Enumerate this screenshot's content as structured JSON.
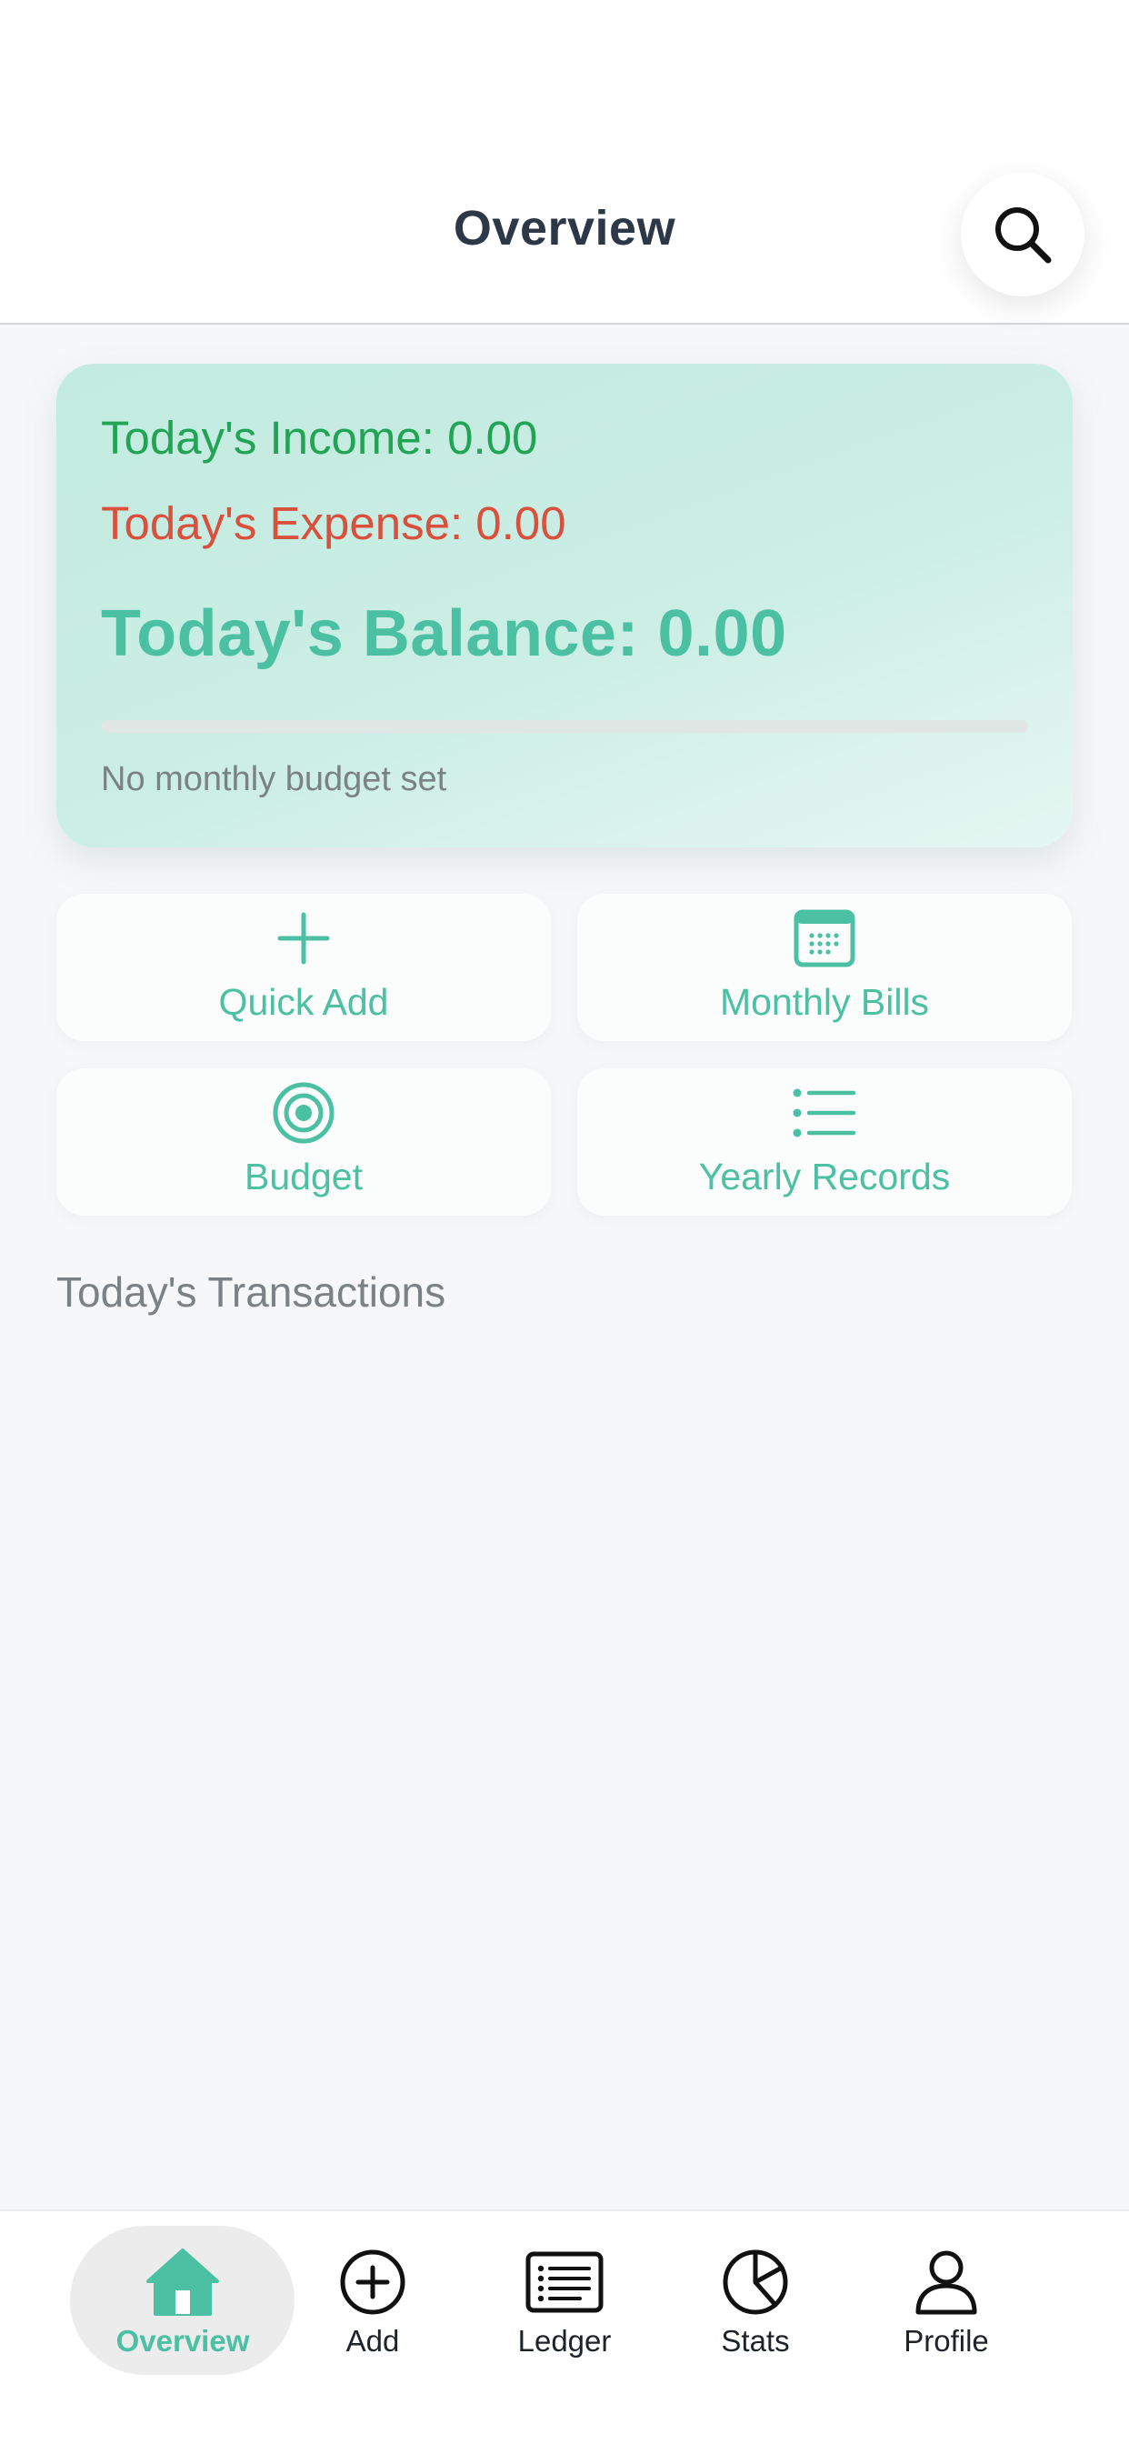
{
  "header": {
    "title": "Overview",
    "search_icon": "search-icon"
  },
  "summary": {
    "income": "Today's Income: 0.00",
    "expense": "Today's Expense: 0.00",
    "balance": "Today's Balance: 0.00",
    "budget_progress": 0,
    "budget_note": "No monthly budget set"
  },
  "actions": {
    "quick_add": {
      "label": "Quick Add",
      "icon": "plus-icon"
    },
    "monthly_bills": {
      "label": "Monthly Bills",
      "icon": "calendar-icon"
    },
    "budget": {
      "label": "Budget",
      "icon": "target-icon"
    },
    "yearly_records": {
      "label": "Yearly Records",
      "icon": "list-icon"
    }
  },
  "transactions": {
    "title": "Today's Transactions"
  },
  "tabbar": {
    "tabs": [
      {
        "label": "Overview",
        "icon": "home-icon",
        "active": true
      },
      {
        "label": "Add",
        "icon": "add-circle-icon",
        "active": false
      },
      {
        "label": "Ledger",
        "icon": "ledger-icon",
        "active": false
      },
      {
        "label": "Stats",
        "icon": "pie-chart-icon",
        "active": false
      },
      {
        "label": "Profile",
        "icon": "person-icon",
        "active": false
      }
    ]
  },
  "colors": {
    "accent": "#4cc0a3",
    "income": "#22a455",
    "expense": "#d9503c",
    "title_text": "#2c3848",
    "muted_text": "#7b8285"
  }
}
